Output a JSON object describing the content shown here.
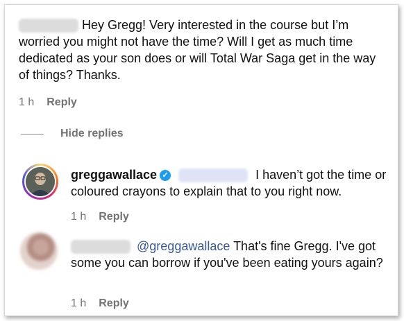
{
  "comments": [
    {
      "text": "Hey Gregg! Very interested in the course but I’m worried you might not have the time? Will I get as much time dedicated as your son does or will Total War Saga get in the way of things? Thanks.",
      "time": "1 h",
      "reply_label": "Reply"
    }
  ],
  "hide_replies_label": "Hide replies",
  "replies": [
    {
      "username": "greggawallace",
      "text": "I haven’t got the time or coloured crayons to explain that to you right now.",
      "time": "1 h",
      "reply_label": "Reply"
    },
    {
      "mention": "@greggawallace",
      "text": "That's fine Gregg. I've got some you can borrow if you've been eating yours again?",
      "time": "1 h",
      "reply_label": "Reply"
    }
  ],
  "colors": {
    "text": "#111111",
    "meta": "#737373",
    "mention": "#385898",
    "verified": "#1d9bf0"
  }
}
